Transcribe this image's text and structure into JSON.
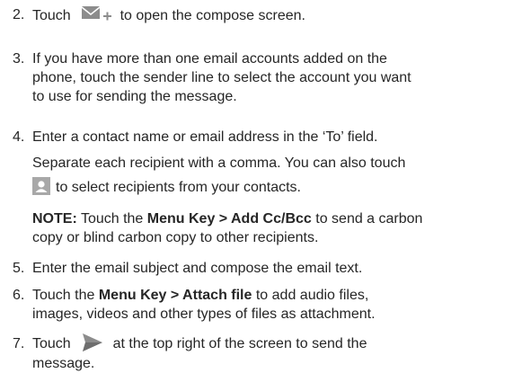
{
  "steps": [
    {
      "number": "2.",
      "before_icon": "Touch",
      "icon": "compose-email-icon",
      "after_icon": "to open the compose screen."
    },
    {
      "number": "3.",
      "line1": "If you have more than one email accounts added on the",
      "line2": "phone, touch the sender line to select the account you want",
      "line3": "to use for sending the message."
    },
    {
      "number": "4.",
      "line1": "Enter a contact name or email address in the ‘To’ field.",
      "line2": "Separate each recipient with a comma. You can also touch",
      "icon": "contact-icon",
      "line3": "to select recipients from your contacts."
    },
    {
      "note_label": "NOTE:",
      "note_text1": "Touch the",
      "note_bold": "Menu Key > Add Cc/Bcc",
      "note_text2": "to send a carbon",
      "note_line2": "copy or blind carbon copy to other recipients."
    },
    {
      "number": "5.",
      "line1": "Enter the email subject and compose the email text."
    },
    {
      "number": "6.",
      "line1a": "Touch the",
      "line1_bold": "Menu Key > Attach file",
      "line1b": "to add audio files,",
      "line2": "images, videos and other types of files as attachment."
    },
    {
      "number": "7.",
      "before_icon": "Touch",
      "icon": "send-icon",
      "after_icon": "at the top right of the screen to send the",
      "line2": "message."
    }
  ],
  "colors": {
    "text": "#262626",
    "icon_gray": "#8c8c8c"
  }
}
